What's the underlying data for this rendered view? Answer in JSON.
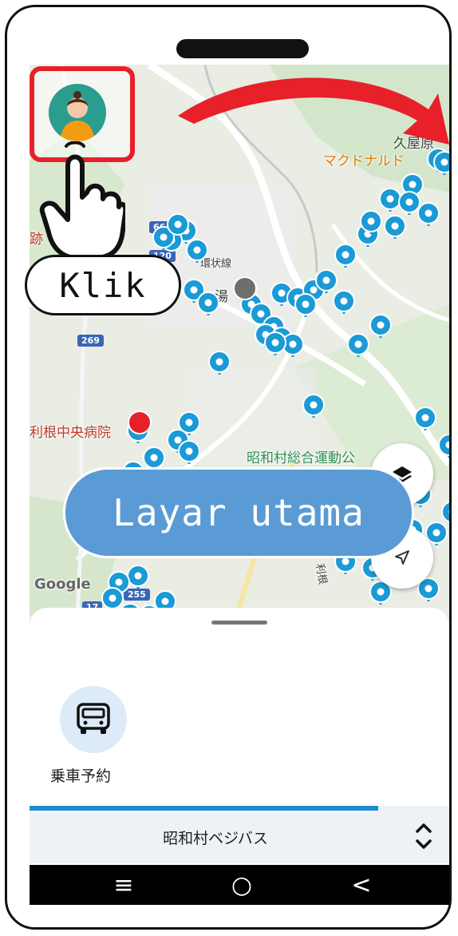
{
  "map": {
    "labels": {
      "place_kuyahara": "久屋原",
      "mcdonalds": "マクドナルド",
      "ring_road": "環状線",
      "onsen": "湯",
      "hospital": "利根中央病院",
      "park": "昭和村総合運動公",
      "left_edge": "跡",
      "road_tone": "利根"
    },
    "road_numbers": [
      "66",
      "120",
      "269",
      "255",
      "17"
    ],
    "attribution": "Google"
  },
  "avatar": {
    "icon": "user-avatar-icon"
  },
  "callouts": {
    "click_label": "Klik",
    "main_screen_label": "Layar utama"
  },
  "sheet": {
    "service_label": "乗車予約",
    "service_icon": "bus-icon",
    "progress_fraction": 0.83,
    "route_name": "昭和村ベジバス"
  },
  "nav": {
    "menu": "≡",
    "home": "○",
    "back": "<"
  },
  "colors": {
    "accent_red": "#e8202a",
    "callout_blue": "#5b9bd5",
    "pin_teal": "#1a9ad6",
    "progress_blue": "#1f8ad1"
  }
}
